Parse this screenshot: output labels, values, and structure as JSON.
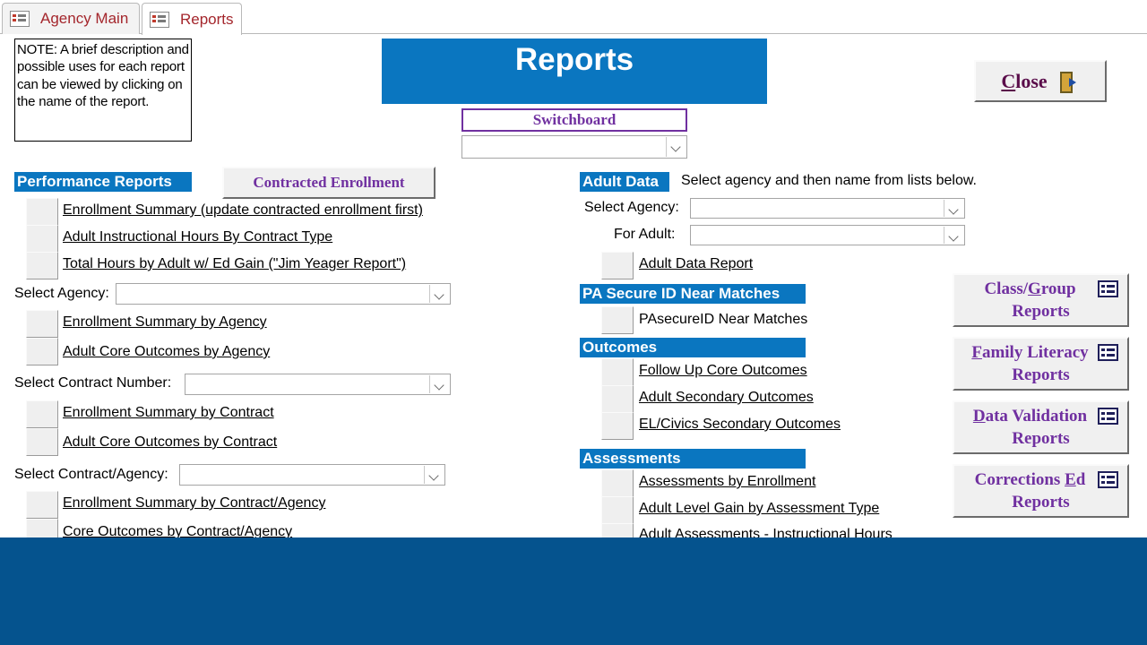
{
  "tabs": [
    {
      "label": "Agency Main",
      "active": false
    },
    {
      "label": "Reports",
      "active": true
    }
  ],
  "note": "NOTE: A brief description and possible uses for each report can be viewed by clicking on the name of the report.",
  "title": "Reports",
  "close_button": {
    "prefix": "",
    "underlined": "C",
    "rest": "lose"
  },
  "switchboard": {
    "label": "Switchboard",
    "value": ""
  },
  "performance": {
    "label": "Performance Reports",
    "contracted_button": "Contracted Enrollment",
    "reports": [
      "Enrollment Summary (update contracted enrollment first)",
      "Adult Instructional Hours By Contract Type",
      "Total Hours by Adult w/ Ed Gain (\"Jim Yeager Report\")"
    ],
    "select_agency_label": "Select Agency:",
    "agency_reports": [
      "Enrollment Summary by Agency",
      "Adult Core Outcomes by Agency"
    ],
    "select_contract_label": "Select Contract Number:",
    "contract_reports": [
      "Enrollment Summary by Contract",
      "Adult Core Outcomes by Contract"
    ],
    "select_contract_agency_label": "Select Contract/Agency:",
    "contract_agency_reports": [
      "Enrollment Summary by Contract/Agency",
      "Core Outcomes by Contract/Agency"
    ]
  },
  "adult_data": {
    "label": "Adult Data",
    "instructions": "Select agency and then name from lists below.",
    "select_agency_label": "Select Agency:",
    "for_adult_label": "For Adult:",
    "report": "Adult Data Report"
  },
  "pa_secure": {
    "label": "PA Secure ID Near Matches",
    "report": "PAsecureID Near Matches"
  },
  "outcomes": {
    "label": "Outcomes",
    "reports": [
      "Follow Up Core Outcomes",
      "Adult Secondary Outcomes",
      "EL/Civics Secondary Outcomes"
    ]
  },
  "assessments": {
    "label": "Assessments",
    "reports": [
      "Assessments by Enrollment",
      "Adult Level Gain by Assessment Type",
      "Adult Assessments - Instructional Hours"
    ]
  },
  "side_buttons": [
    {
      "pre": "Class/",
      "u": "G",
      "post": "roup",
      "line2": "Reports"
    },
    {
      "pre": "",
      "u": "F",
      "post": "amily Literacy",
      "line2": "Reports"
    },
    {
      "pre": "",
      "u": "D",
      "post": "ata Validation",
      "line2": "Reports"
    },
    {
      "pre": "Corrections ",
      "u": "E",
      "post": "d",
      "line2": "Reports"
    }
  ],
  "colors": {
    "accent_blue": "#0a76c0",
    "purple": "#7030a0",
    "tab_text": "#a4262c",
    "footer": "#05538e"
  },
  "icons": {
    "tab": "form-icon",
    "close": "exit-door-icon",
    "side": "form-icon"
  }
}
